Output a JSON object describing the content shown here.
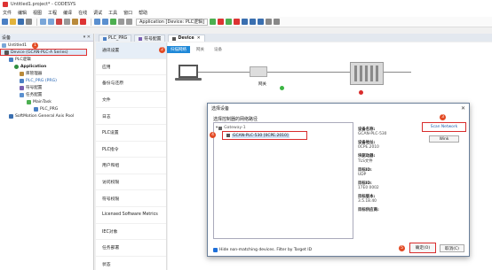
{
  "window": {
    "title": "Untitled1.project* - CODESYS"
  },
  "menu": {
    "items": [
      "文件",
      "编辑",
      "视图",
      "工程",
      "编译",
      "在线",
      "调试",
      "工具",
      "窗口",
      "帮助"
    ]
  },
  "toolbar": {
    "device_combo": "Application [Device: PLC逻辑]"
  },
  "device_panel": {
    "title": "设备",
    "header_icons": "▾ ✕",
    "tree": [
      {
        "label": "Untitled1",
        "marker": "1"
      },
      {
        "label": "Device (GCAN-PLC-A Series)"
      },
      {
        "label": "PLC逻辑"
      },
      {
        "label": "Application"
      },
      {
        "label": "库管理器"
      },
      {
        "label": "PLC_PRG (PRG)"
      },
      {
        "label": "符号配置"
      },
      {
        "label": "任务配置"
      },
      {
        "label": "MainTask"
      },
      {
        "label": "PLC_PRG"
      },
      {
        "label": "SoftMotion General Axis Pool"
      }
    ]
  },
  "editor_tabs": [
    {
      "label": "PLC_PRG"
    },
    {
      "label": "符号配置"
    },
    {
      "label": "Device"
    }
  ],
  "side_nav": {
    "items": [
      "通讯设置",
      "应用",
      "备份与还原",
      "文件",
      "日志",
      "PLC设置",
      "PLC指令",
      "用户和组",
      "访问权限",
      "符号权限",
      "Licensed Software Metrics",
      "IEC对象",
      "任务部署",
      "状态",
      "信息"
    ]
  },
  "subtabs": [
    "扫描网络",
    "网关",
    "设备"
  ],
  "diagram": {
    "gateway_label": "网关"
  },
  "dialog": {
    "title": "选择设备",
    "list_label": "选择控制器的网络路径",
    "gateway_item": "Gateway-1",
    "device_item": "GCAN-PLC-530 [0CPE.2010]",
    "info": [
      {
        "label": "设备名称:",
        "value": "GCAN-PLC-530"
      },
      {
        "label": "设备地址:",
        "value": "0CPE.2010"
      },
      {
        "label": "块驱动器:",
        "value": "TLS文件"
      },
      {
        "label": "目标ID:",
        "value": "UDP"
      },
      {
        "label": "目标ID:",
        "value": "17E0 0002"
      },
      {
        "label": "目标版本:",
        "value": "3.5.18.40"
      },
      {
        "label": "目标供应商:",
        "value": ""
      }
    ],
    "scan_button": "Scan Network",
    "wink_button": "Wink",
    "filter_label": "Hide non-matching devices. Filter by Target ID",
    "ok_button": "确定(O)",
    "cancel_button": "取消(C)"
  },
  "markers": {
    "m1": "1",
    "m2": "2",
    "m3": "3",
    "m4": "4",
    "m5": "5"
  }
}
